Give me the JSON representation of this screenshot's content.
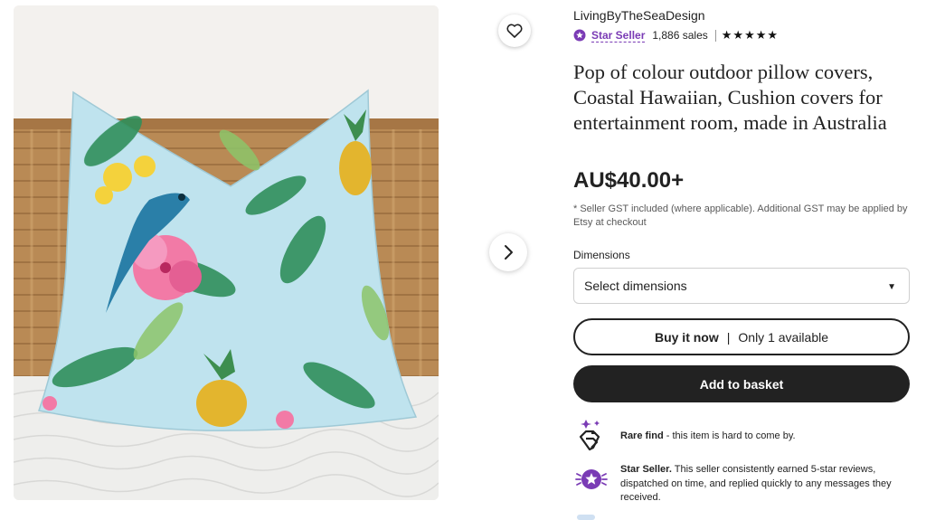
{
  "shop": {
    "name": "LivingByTheSeaDesign",
    "star_seller_label": "Star Seller",
    "sales": "1,886 sales",
    "rating_stars": "★★★★★"
  },
  "listing": {
    "title": "Pop of colour outdoor pillow covers, Coastal Hawaiian, Cushion covers for entertainment room, made in Australia",
    "price": "AU$40.00+",
    "gst_note": "* Seller GST included (where applicable). Additional GST may be applied by Etsy at checkout"
  },
  "options": {
    "dimensions_label": "Dimensions",
    "dimensions_value": "Select dimensions"
  },
  "buttons": {
    "buy_now": "Buy it now",
    "availability": "Only 1 available",
    "add_to_basket": "Add to basket"
  },
  "features": [
    {
      "title": "Rare find",
      "text": " - this item is hard to come by."
    },
    {
      "title": "Star Seller.",
      "text": " This seller consistently earned 5-star reviews, dispatched on time, and replied quickly to any messages they received."
    }
  ],
  "icons": {
    "favorite": "heart-icon",
    "next_image": "chevron-right-icon",
    "select_caret": "caret-down-icon",
    "rare_find": "diamond-hand-icon",
    "star_seller": "star-badge-icon"
  },
  "colors": {
    "star_seller_purple": "#7a3bb5",
    "primary_button": "#222222",
    "pillow_base": "#bfe3ee"
  }
}
